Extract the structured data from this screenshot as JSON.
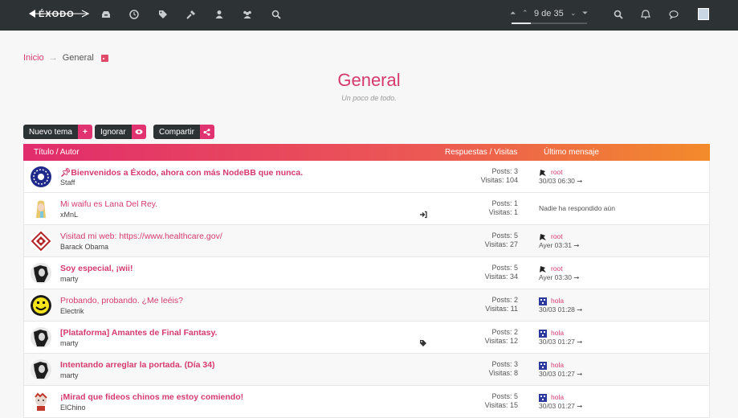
{
  "navbar": {
    "logo_text": "ÉXODO",
    "icons": [
      "inbox-icon",
      "clock-icon",
      "tags-icon",
      "hammer-icon",
      "user-icon",
      "group-icon",
      "search-icon"
    ],
    "pager_text": "9 de 35",
    "pager_progress": 0.26,
    "right_icons": [
      "search-icon",
      "bell-icon",
      "chat-icon",
      "user-avatar"
    ]
  },
  "breadcrumb": {
    "home": "Inicio",
    "separator": "→",
    "current": "General"
  },
  "category": {
    "title": "General",
    "subtitle": "Un poco de todo."
  },
  "buttons": {
    "new_topic": "Nuevo tema",
    "new_topic_icon": "+",
    "ignore": "Ignorar",
    "share": "Compartir"
  },
  "table": {
    "col_title": "Título / Autor",
    "col_stats": "Respuestas / Visitas",
    "col_last": "Último mensaje",
    "rows": [
      {
        "title": "Bienvenidos a Éxodo, ahora con más NodeBB que nunca.",
        "author": "Staff",
        "posts": "Posts: 3",
        "views": "Visitas: 104",
        "last_user": "root",
        "last_time": "30/03 06:30 ➞",
        "pinned": true,
        "bold": true
      },
      {
        "title": "Mi waifu es Lana Del Rey.",
        "author": "xMnL",
        "posts": "Posts: 1",
        "views": "Visitas: 1",
        "no_reply": "Nadie ha respondido aún"
      },
      {
        "title": "Visitad mi web: https://www.healthcare.gov/",
        "author": "Barack Obama",
        "posts": "Posts: 5",
        "views": "Visitas: 27",
        "last_user": "root",
        "last_time": "Ayer 03:31 ➞"
      },
      {
        "title": "Soy especial, ¡wii!",
        "author": "marty",
        "posts": "Posts: 5",
        "views": "Visitas: 34",
        "last_user": "root",
        "last_time": "Ayer 03:30 ➞",
        "bold": true
      },
      {
        "title": "Probando, probando. ¿Me leéis?",
        "author": "Electrik",
        "posts": "Posts: 2",
        "views": "Visitas: 11",
        "last_user": "hola",
        "last_time": "30/03 01:28 ➞"
      },
      {
        "title": "[Plataforma] Amantes de Final Fantasy.",
        "author": "marty",
        "posts": "Posts: 2",
        "views": "Visitas: 12",
        "last_user": "hola",
        "last_time": "30/03 01:27 ➞",
        "bold": true
      },
      {
        "title": "Intentando arreglar la portada. (Día 34)",
        "author": "marty",
        "posts": "Posts: 3",
        "views": "Visitas: 8",
        "last_user": "hola",
        "last_time": "30/03 01:27 ➞",
        "bold": true
      },
      {
        "title": "¡Mirad que fideos chinos me estoy comiendo!",
        "author": "ElChino",
        "posts": "Posts: 5",
        "views": "Visitas: 15",
        "last_user": "hola",
        "last_time": "30/03 01:27 ➞",
        "bold": true
      }
    ]
  },
  "colors": {
    "accent": "#d43a6e",
    "navbar": "#2d3235",
    "gradient_start": "#e12c6d",
    "gradient_end": "#f38b2b"
  }
}
